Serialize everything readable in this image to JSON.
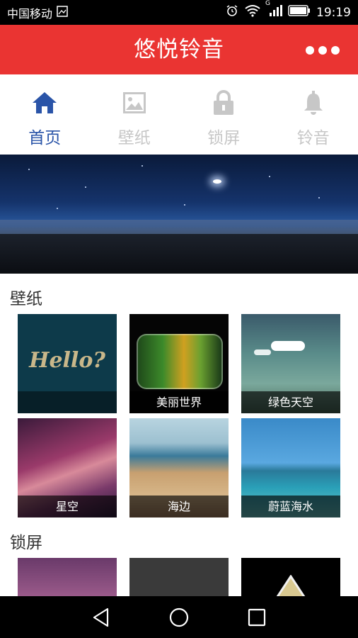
{
  "status_bar": {
    "carrier": "中国移动",
    "network_type": "G",
    "time": "19:19"
  },
  "title_bar": {
    "title": "悠悦铃音",
    "menu_icon": "more-dots-icon"
  },
  "tabs": [
    {
      "label": "首页",
      "icon": "home-icon",
      "active": true
    },
    {
      "label": "壁纸",
      "icon": "picture-icon",
      "active": false
    },
    {
      "label": "锁屏",
      "icon": "lock-icon",
      "active": false
    },
    {
      "label": "铃音",
      "icon": "bell-icon",
      "active": false
    }
  ],
  "colors": {
    "brand_red": "#ea3432",
    "tab_active": "#2a54a8",
    "tab_inactive": "#c7c7c7"
  },
  "sections": {
    "wallpaper": {
      "title": "壁纸",
      "items": [
        {
          "caption": "",
          "overlay_text": "Hello?"
        },
        {
          "caption": "美丽世界"
        },
        {
          "caption": "绿色天空"
        },
        {
          "caption": "星空"
        },
        {
          "caption": "海边"
        },
        {
          "caption": "蔚蓝海水"
        }
      ]
    },
    "lockscreen": {
      "title": "锁屏"
    }
  },
  "nav": {
    "back": "back-triangle-icon",
    "home": "home-circle-icon",
    "recents": "recents-square-icon"
  }
}
